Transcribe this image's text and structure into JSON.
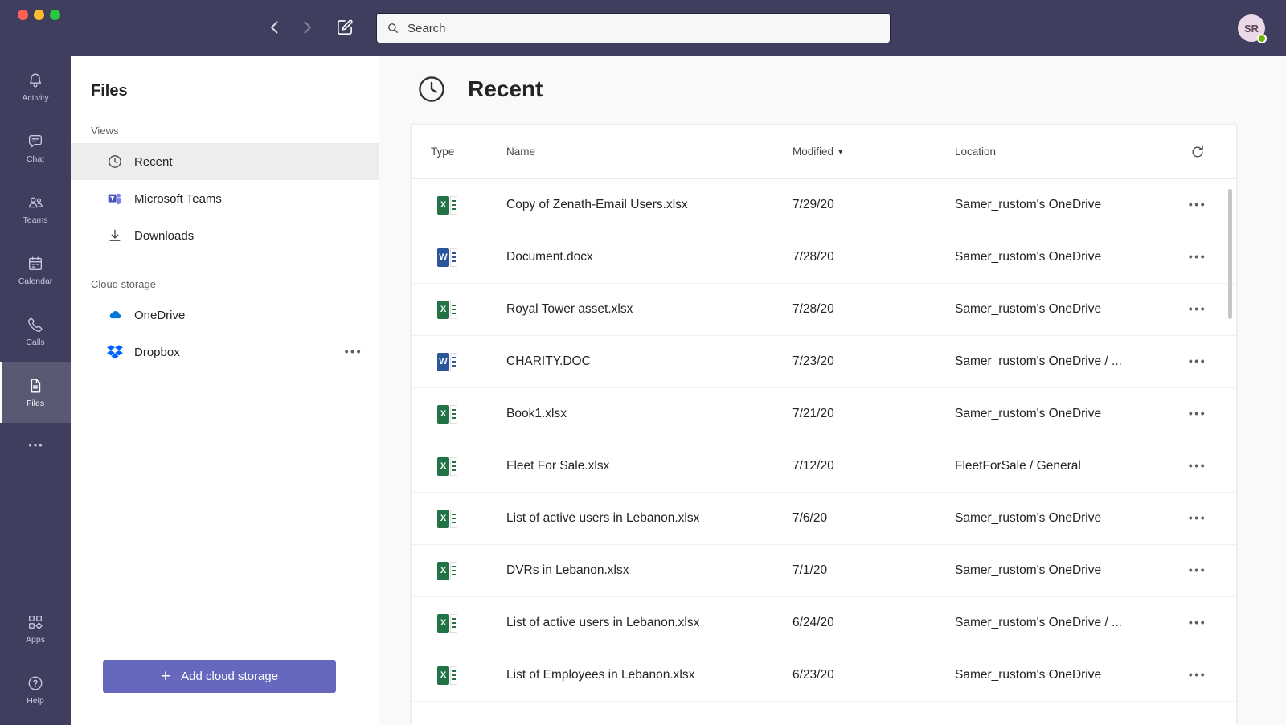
{
  "colors": {
    "titlebar": "#3F3E5E",
    "accent": "#6568BC",
    "excel_green": "#217346",
    "word_blue": "#2B579A",
    "onedrive_blue": "#0078D4",
    "dropbox_blue": "#0061FF",
    "presence_available": "#6BB700",
    "selected_row_bg": "#EDEDED"
  },
  "topbar": {
    "search_placeholder": "Search",
    "avatar_initials": "SR"
  },
  "rail": {
    "items": [
      {
        "label": "Activity",
        "icon": "bell-icon"
      },
      {
        "label": "Chat",
        "icon": "chat-icon"
      },
      {
        "label": "Teams",
        "icon": "people-icon"
      },
      {
        "label": "Calendar",
        "icon": "calendar-icon"
      },
      {
        "label": "Calls",
        "icon": "phone-icon"
      },
      {
        "label": "Files",
        "icon": "document-icon",
        "active": true
      },
      {
        "label": "",
        "icon": "more-icon"
      }
    ],
    "bottom": [
      {
        "label": "Apps",
        "icon": "apps-icon"
      },
      {
        "label": "Help",
        "icon": "help-icon"
      }
    ]
  },
  "sidebar": {
    "title": "Files",
    "views_label": "Views",
    "views": [
      {
        "label": "Recent",
        "icon": "clock-icon",
        "selected": true
      },
      {
        "label": "Microsoft Teams",
        "icon": "teams-logo-icon"
      },
      {
        "label": "Downloads",
        "icon": "download-icon"
      }
    ],
    "cloud_label": "Cloud storage",
    "cloud": [
      {
        "label": "OneDrive",
        "icon": "onedrive-icon"
      },
      {
        "label": "Dropbox",
        "icon": "dropbox-icon",
        "has_more": true
      }
    ],
    "add_button": "Add cloud storage"
  },
  "main": {
    "title": "Recent",
    "columns": {
      "type": "Type",
      "name": "Name",
      "modified": "Modified",
      "location": "Location"
    },
    "sort": {
      "column": "Modified",
      "direction": "desc"
    },
    "rows": [
      {
        "icon": "excel",
        "name": "Copy of Zenath-Email Users.xlsx",
        "modified": "7/29/20",
        "location": "Samer_rustom's OneDrive"
      },
      {
        "icon": "word",
        "name": "Document.docx",
        "modified": "7/28/20",
        "location": "Samer_rustom's OneDrive"
      },
      {
        "icon": "excel",
        "name": "Royal Tower asset.xlsx",
        "modified": "7/28/20",
        "location": "Samer_rustom's OneDrive"
      },
      {
        "icon": "word",
        "name": "CHARITY.DOC",
        "modified": "7/23/20",
        "location": "Samer_rustom's OneDrive / ..."
      },
      {
        "icon": "excel",
        "name": "Book1.xlsx",
        "modified": "7/21/20",
        "location": "Samer_rustom's OneDrive"
      },
      {
        "icon": "excel",
        "name": "Fleet For Sale.xlsx",
        "modified": "7/12/20",
        "location": "FleetForSale / General"
      },
      {
        "icon": "excel",
        "name": "List of active users in Lebanon.xlsx",
        "modified": "7/6/20",
        "location": "Samer_rustom's OneDrive"
      },
      {
        "icon": "excel",
        "name": "DVRs in Lebanon.xlsx",
        "modified": "7/1/20",
        "location": "Samer_rustom's OneDrive"
      },
      {
        "icon": "excel",
        "name": "List of active users in Lebanon.xlsx",
        "modified": "6/24/20",
        "location": "Samer_rustom's OneDrive / ..."
      },
      {
        "icon": "excel",
        "name": "List of Employees in Lebanon.xlsx",
        "modified": "6/23/20",
        "location": "Samer_rustom's OneDrive"
      }
    ]
  }
}
